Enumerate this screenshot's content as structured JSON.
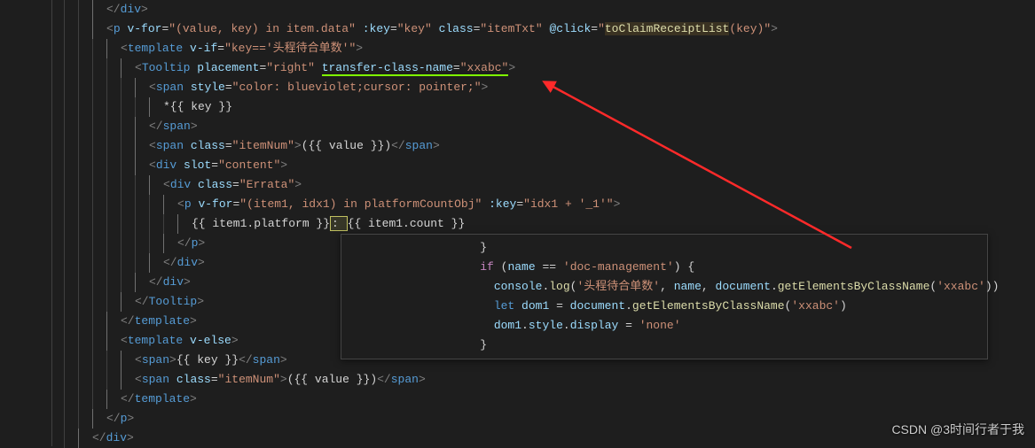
{
  "lines": [
    {
      "indent": 3,
      "tokens": [
        {
          "t": "</",
          "c": "tag-bracket"
        },
        {
          "t": "div",
          "c": "tag-name"
        },
        {
          "t": ">",
          "c": "tag-bracket"
        }
      ]
    },
    {
      "indent": 3,
      "tokens": [
        {
          "t": "<",
          "c": "tag-bracket"
        },
        {
          "t": "p",
          "c": "tag-name"
        },
        {
          "t": " ",
          "c": ""
        },
        {
          "t": "v-for",
          "c": "attr-name"
        },
        {
          "t": "=",
          "c": "attr-equals"
        },
        {
          "t": "\"(value, key) in item.data\"",
          "c": "attr-value"
        },
        {
          "t": " ",
          "c": ""
        },
        {
          "t": ":key",
          "c": "attr-name"
        },
        {
          "t": "=",
          "c": "attr-equals"
        },
        {
          "t": "\"key\"",
          "c": "attr-value"
        },
        {
          "t": " ",
          "c": ""
        },
        {
          "t": "class",
          "c": "attr-name"
        },
        {
          "t": "=",
          "c": "attr-equals"
        },
        {
          "t": "\"itemTxt\"",
          "c": "attr-value"
        },
        {
          "t": " ",
          "c": ""
        },
        {
          "t": "@click",
          "c": "attr-name"
        },
        {
          "t": "=",
          "c": "attr-equals"
        },
        {
          "t": "\"",
          "c": "attr-value"
        },
        {
          "t": "toClaimReceiptList",
          "c": "func",
          "bg": "rgba(100,80,40,0.4)"
        },
        {
          "t": "(key)\"",
          "c": "attr-value"
        },
        {
          "t": ">",
          "c": "tag-bracket"
        }
      ]
    },
    {
      "indent": 4,
      "tokens": [
        {
          "t": "<",
          "c": "tag-bracket"
        },
        {
          "t": "template",
          "c": "tag-name"
        },
        {
          "t": " ",
          "c": ""
        },
        {
          "t": "v-if",
          "c": "attr-name"
        },
        {
          "t": "=",
          "c": "attr-equals"
        },
        {
          "t": "\"key=='头程待合单数'\"",
          "c": "attr-value"
        },
        {
          "t": ">",
          "c": "tag-bracket"
        }
      ]
    },
    {
      "indent": 5,
      "tokens": [
        {
          "t": "<",
          "c": "tag-bracket"
        },
        {
          "t": "Tooltip",
          "c": "tag-name"
        },
        {
          "t": " ",
          "c": ""
        },
        {
          "t": "placement",
          "c": "attr-name"
        },
        {
          "t": "=",
          "c": "attr-equals"
        },
        {
          "t": "\"right\"",
          "c": "attr-value"
        },
        {
          "t": " ",
          "c": ""
        },
        {
          "t": "transfer-class-name",
          "c": "attr-name",
          "underline": true
        },
        {
          "t": "=",
          "c": "attr-equals",
          "underline": true
        },
        {
          "t": "\"xxabc\"",
          "c": "attr-value",
          "underline": true
        },
        {
          "t": ">",
          "c": "tag-bracket"
        }
      ]
    },
    {
      "indent": 6,
      "tokens": [
        {
          "t": "<",
          "c": "tag-bracket"
        },
        {
          "t": "span",
          "c": "tag-name"
        },
        {
          "t": " ",
          "c": ""
        },
        {
          "t": "style",
          "c": "attr-name"
        },
        {
          "t": "=",
          "c": "attr-equals"
        },
        {
          "t": "\"color: blueviolet;cursor: pointer;\"",
          "c": "attr-value"
        },
        {
          "t": ">",
          "c": "tag-bracket"
        }
      ]
    },
    {
      "indent": 7,
      "tokens": [
        {
          "t": "*{{ key }}",
          "c": "text"
        }
      ]
    },
    {
      "indent": 6,
      "tokens": [
        {
          "t": "</",
          "c": "tag-bracket"
        },
        {
          "t": "span",
          "c": "tag-name"
        },
        {
          "t": ">",
          "c": "tag-bracket"
        }
      ]
    },
    {
      "indent": 6,
      "tokens": [
        {
          "t": "<",
          "c": "tag-bracket"
        },
        {
          "t": "span",
          "c": "tag-name"
        },
        {
          "t": " ",
          "c": ""
        },
        {
          "t": "class",
          "c": "attr-name"
        },
        {
          "t": "=",
          "c": "attr-equals"
        },
        {
          "t": "\"itemNum\"",
          "c": "attr-value"
        },
        {
          "t": ">",
          "c": "tag-bracket"
        },
        {
          "t": "({{ value }})",
          "c": "text"
        },
        {
          "t": "</",
          "c": "tag-bracket"
        },
        {
          "t": "span",
          "c": "tag-name"
        },
        {
          "t": ">",
          "c": "tag-bracket"
        }
      ]
    },
    {
      "indent": 6,
      "tokens": [
        {
          "t": "<",
          "c": "tag-bracket"
        },
        {
          "t": "div",
          "c": "tag-name"
        },
        {
          "t": " ",
          "c": ""
        },
        {
          "t": "slot",
          "c": "attr-name"
        },
        {
          "t": "=",
          "c": "attr-equals"
        },
        {
          "t": "\"content\"",
          "c": "attr-value"
        },
        {
          "t": ">",
          "c": "tag-bracket"
        }
      ]
    },
    {
      "indent": 7,
      "tokens": [
        {
          "t": "<",
          "c": "tag-bracket"
        },
        {
          "t": "div",
          "c": "tag-name"
        },
        {
          "t": " ",
          "c": ""
        },
        {
          "t": "class",
          "c": "attr-name"
        },
        {
          "t": "=",
          "c": "attr-equals"
        },
        {
          "t": "\"Errata\"",
          "c": "attr-value"
        },
        {
          "t": ">",
          "c": "tag-bracket"
        }
      ]
    },
    {
      "indent": 8,
      "tokens": [
        {
          "t": "<",
          "c": "tag-bracket"
        },
        {
          "t": "p",
          "c": "tag-name"
        },
        {
          "t": " ",
          "c": ""
        },
        {
          "t": "v-for",
          "c": "attr-name"
        },
        {
          "t": "=",
          "c": "attr-equals"
        },
        {
          "t": "\"(item1, idx1) in platformCountObj\"",
          "c": "attr-value"
        },
        {
          "t": " ",
          "c": ""
        },
        {
          "t": ":key",
          "c": "attr-name"
        },
        {
          "t": "=",
          "c": "attr-equals"
        },
        {
          "t": "\"idx1 + '_1'\"",
          "c": "attr-value"
        },
        {
          "t": ">",
          "c": "tag-bracket"
        }
      ]
    },
    {
      "indent": 9,
      "tokens": [
        {
          "t": "{{ item1.platform }}",
          "c": "text"
        },
        {
          "t": ": ",
          "c": "text",
          "box": true
        },
        {
          "t": "{{ item1.count }}",
          "c": "text"
        }
      ]
    },
    {
      "indent": 8,
      "tokens": [
        {
          "t": "</",
          "c": "tag-bracket"
        },
        {
          "t": "p",
          "c": "tag-name"
        },
        {
          "t": ">",
          "c": "tag-bracket"
        }
      ]
    },
    {
      "indent": 7,
      "tokens": [
        {
          "t": "</",
          "c": "tag-bracket"
        },
        {
          "t": "div",
          "c": "tag-name"
        },
        {
          "t": ">",
          "c": "tag-bracket"
        }
      ]
    },
    {
      "indent": 6,
      "tokens": [
        {
          "t": "</",
          "c": "tag-bracket"
        },
        {
          "t": "div",
          "c": "tag-name"
        },
        {
          "t": ">",
          "c": "tag-bracket"
        }
      ]
    },
    {
      "indent": 5,
      "tokens": [
        {
          "t": "</",
          "c": "tag-bracket"
        },
        {
          "t": "Tooltip",
          "c": "tag-name"
        },
        {
          "t": ">",
          "c": "tag-bracket"
        }
      ]
    },
    {
      "indent": 4,
      "tokens": [
        {
          "t": "</",
          "c": "tag-bracket"
        },
        {
          "t": "template",
          "c": "tag-name"
        },
        {
          "t": ">",
          "c": "tag-bracket"
        }
      ]
    },
    {
      "indent": 4,
      "tokens": [
        {
          "t": "<",
          "c": "tag-bracket"
        },
        {
          "t": "template",
          "c": "tag-name"
        },
        {
          "t": " ",
          "c": ""
        },
        {
          "t": "v-else",
          "c": "attr-name"
        },
        {
          "t": ">",
          "c": "tag-bracket"
        }
      ]
    },
    {
      "indent": 5,
      "tokens": [
        {
          "t": "<",
          "c": "tag-bracket"
        },
        {
          "t": "span",
          "c": "tag-name"
        },
        {
          "t": ">",
          "c": "tag-bracket"
        },
        {
          "t": "{{ key }}",
          "c": "text"
        },
        {
          "t": "</",
          "c": "tag-bracket"
        },
        {
          "t": "span",
          "c": "tag-name"
        },
        {
          "t": ">",
          "c": "tag-bracket"
        }
      ]
    },
    {
      "indent": 5,
      "tokens": [
        {
          "t": "<",
          "c": "tag-bracket"
        },
        {
          "t": "span",
          "c": "tag-name"
        },
        {
          "t": " ",
          "c": ""
        },
        {
          "t": "class",
          "c": "attr-name"
        },
        {
          "t": "=",
          "c": "attr-equals"
        },
        {
          "t": "\"itemNum\"",
          "c": "attr-value"
        },
        {
          "t": ">",
          "c": "tag-bracket"
        },
        {
          "t": "({{ value }})",
          "c": "text"
        },
        {
          "t": "</",
          "c": "tag-bracket"
        },
        {
          "t": "span",
          "c": "tag-name"
        },
        {
          "t": ">",
          "c": "tag-bracket"
        }
      ]
    },
    {
      "indent": 4,
      "tokens": [
        {
          "t": "</",
          "c": "tag-bracket"
        },
        {
          "t": "template",
          "c": "tag-name"
        },
        {
          "t": ">",
          "c": "tag-bracket"
        }
      ]
    },
    {
      "indent": 3,
      "tokens": [
        {
          "t": "</",
          "c": "tag-bracket"
        },
        {
          "t": "p",
          "c": "tag-name"
        },
        {
          "t": ">",
          "c": "tag-bracket"
        }
      ]
    },
    {
      "indent": 2,
      "tokens": [
        {
          "t": "</",
          "c": "tag-bracket"
        },
        {
          "t": "div",
          "c": "tag-name"
        },
        {
          "t": ">",
          "c": "tag-bracket"
        }
      ]
    }
  ],
  "popup_lines": [
    [
      {
        "t": "                   }",
        "c": "text"
      }
    ],
    [
      {
        "t": "                   ",
        "c": ""
      },
      {
        "t": "if",
        "c": "keyword"
      },
      {
        "t": " (",
        "c": "text"
      },
      {
        "t": "name",
        "c": "var"
      },
      {
        "t": " == ",
        "c": "text"
      },
      {
        "t": "'doc-management'",
        "c": "string"
      },
      {
        "t": ") {",
        "c": "text"
      }
    ],
    [
      {
        "t": "                     ",
        "c": ""
      },
      {
        "t": "console",
        "c": "var"
      },
      {
        "t": ".",
        "c": "text"
      },
      {
        "t": "log",
        "c": "func"
      },
      {
        "t": "(",
        "c": "text"
      },
      {
        "t": "'头程待合单数'",
        "c": "string"
      },
      {
        "t": ", ",
        "c": "text"
      },
      {
        "t": "name",
        "c": "var"
      },
      {
        "t": ", ",
        "c": "text"
      },
      {
        "t": "document",
        "c": "var"
      },
      {
        "t": ".",
        "c": "text"
      },
      {
        "t": "getElementsByClassName",
        "c": "func"
      },
      {
        "t": "(",
        "c": "text"
      },
      {
        "t": "'xxabc'",
        "c": "string"
      },
      {
        "t": "))",
        "c": "text"
      }
    ],
    [
      {
        "t": "                     ",
        "c": ""
      },
      {
        "t": "let",
        "c": "keyword-blue"
      },
      {
        "t": " ",
        "c": ""
      },
      {
        "t": "dom1",
        "c": "var"
      },
      {
        "t": " = ",
        "c": "text"
      },
      {
        "t": "document",
        "c": "var"
      },
      {
        "t": ".",
        "c": "text"
      },
      {
        "t": "getElementsByClassName",
        "c": "func"
      },
      {
        "t": "(",
        "c": "text"
      },
      {
        "t": "'xxabc'",
        "c": "string"
      },
      {
        "t": ")",
        "c": "text"
      }
    ],
    [
      {
        "t": "                     ",
        "c": ""
      },
      {
        "t": "dom1",
        "c": "var"
      },
      {
        "t": ".",
        "c": "text"
      },
      {
        "t": "style",
        "c": "var"
      },
      {
        "t": ".",
        "c": "text"
      },
      {
        "t": "display",
        "c": "var"
      },
      {
        "t": " = ",
        "c": "text"
      },
      {
        "t": "'none'",
        "c": "string"
      }
    ],
    [
      {
        "t": "                   }",
        "c": "text"
      }
    ]
  ],
  "watermark": "CSDN @3时间行者于我"
}
